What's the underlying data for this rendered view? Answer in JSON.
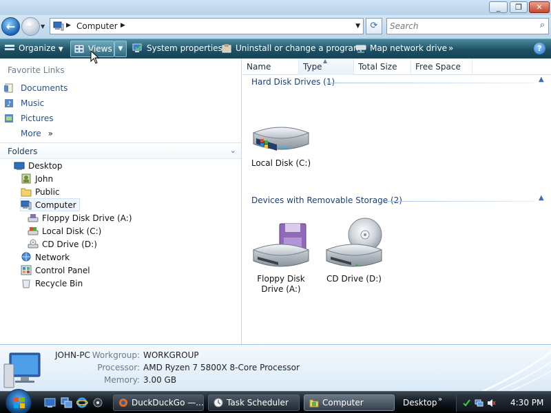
{
  "window": {
    "controls": {
      "minimize": "_",
      "maximize": "❐",
      "close": "✕"
    }
  },
  "address": {
    "path": "Computer",
    "search_placeholder": "Search"
  },
  "toolbar": {
    "organize": "Organize",
    "views": "Views",
    "system_properties": "System properties",
    "uninstall": "Uninstall or change a program",
    "map_drive": "Map network drive",
    "more": "»",
    "help": "?"
  },
  "nav": {
    "favorites_header": "Favorite Links",
    "favorites": [
      {
        "label": "Documents"
      },
      {
        "label": "Music"
      },
      {
        "label": "Pictures"
      }
    ],
    "more": "More",
    "more_chev": "»",
    "folders_header": "Folders",
    "tree": [
      {
        "label": "Desktop"
      },
      {
        "label": "John"
      },
      {
        "label": "Public"
      },
      {
        "label": "Computer"
      },
      {
        "label": "Floppy Disk Drive (A:)"
      },
      {
        "label": "Local Disk (C:)"
      },
      {
        "label": "CD Drive (D:)"
      },
      {
        "label": "Network"
      },
      {
        "label": "Control Panel"
      },
      {
        "label": "Recycle Bin"
      }
    ]
  },
  "content": {
    "columns": [
      "Name",
      "Type",
      "Total Size",
      "Free Space"
    ],
    "groups": [
      {
        "title": "Hard Disk Drives (1)",
        "items": [
          {
            "label": "Local Disk (C:)",
            "icon": "hard-disk-icon"
          }
        ]
      },
      {
        "title": "Devices with Removable Storage (2)",
        "items": [
          {
            "label": "Floppy Disk Drive (A:)",
            "icon": "floppy-drive-icon"
          },
          {
            "label": "CD Drive (D:)",
            "icon": "cd-drive-icon"
          }
        ]
      }
    ]
  },
  "details": {
    "computer_name": "JOHN-PC",
    "workgroup_label": "Workgroup:",
    "workgroup": "WORKGROUP",
    "processor_label": "Processor:",
    "processor": "AMD Ryzen 7 5800X 8-Core Processor",
    "memory_label": "Memory:",
    "memory": "3.00 GB"
  },
  "taskbar": {
    "tasks": [
      {
        "label": "DuckDuckGo —..."
      },
      {
        "label": "Task Scheduler"
      },
      {
        "label": "Computer"
      }
    ],
    "desktop_label": "Desktop",
    "desktop_chev": "»",
    "clock": "4:30 PM"
  },
  "colors": {
    "command_bar": "#1e4f63",
    "link": "#1e4f9c",
    "group_header": "#1e3f75"
  }
}
